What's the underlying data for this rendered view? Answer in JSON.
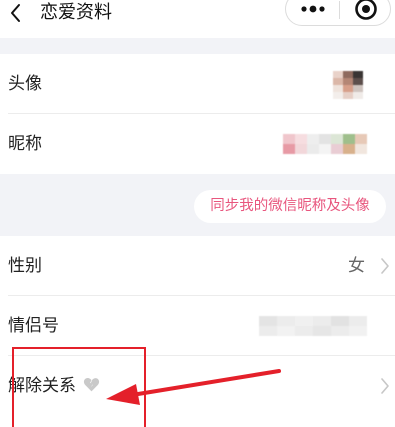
{
  "header": {
    "back_icon": "chevron-left-icon",
    "title": "恋爱资料",
    "more_icon": "more-dots-icon",
    "home_icon": "target-icon"
  },
  "profile": {
    "avatar_label": "头像",
    "nickname_label": "昵称"
  },
  "sync_button": "同步我的微信昵称及头像",
  "info": {
    "gender_label": "性别",
    "gender_value": "女",
    "couple_id_label": "情侣号",
    "unbind_label": "解除关系",
    "unbind_icon": "broken-heart-icon"
  },
  "colors": {
    "accent": "#e8567e",
    "annotation": "#e4202a"
  }
}
